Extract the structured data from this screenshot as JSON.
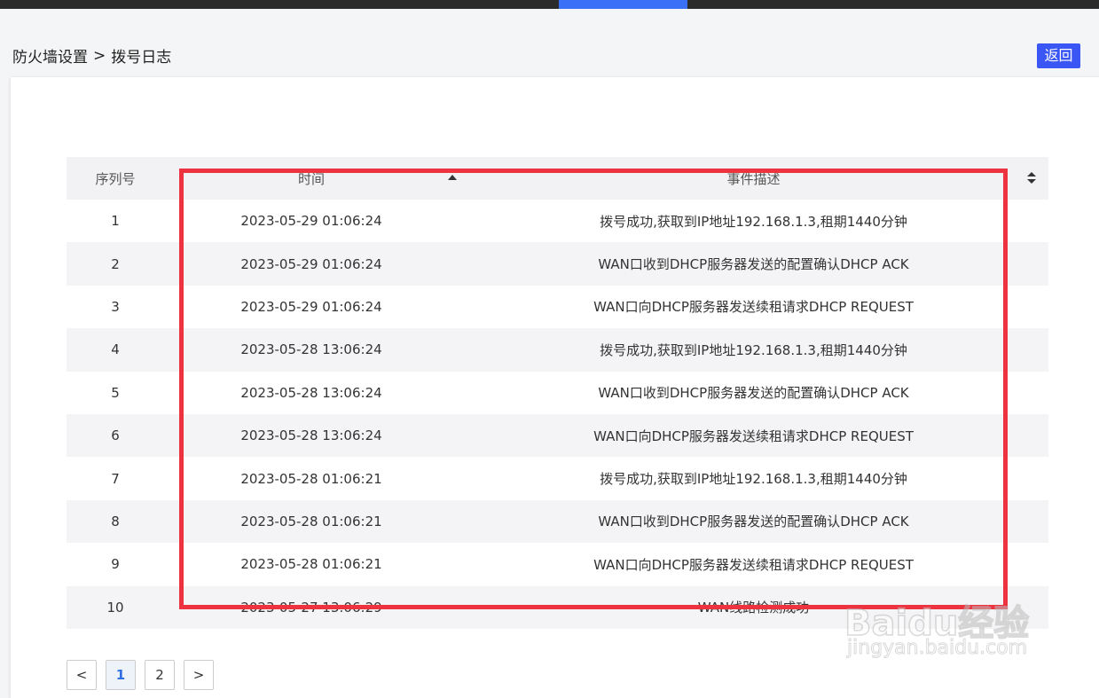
{
  "breadcrumb": {
    "parent": "防火墙设置",
    "separator": ">",
    "current": "拨号日志"
  },
  "back_button": "返回",
  "table": {
    "headers": [
      "序列号",
      "时间",
      "事件描述"
    ],
    "rows": [
      {
        "seq": "1",
        "time": "2023-05-29 01:06:24",
        "desc": "拨号成功,获取到IP地址192.168.1.3,租期1440分钟"
      },
      {
        "seq": "2",
        "time": "2023-05-29 01:06:24",
        "desc": "WAN口收到DHCP服务器发送的配置确认DHCP ACK"
      },
      {
        "seq": "3",
        "time": "2023-05-29 01:06:24",
        "desc": "WAN口向DHCP服务器发送续租请求DHCP REQUEST"
      },
      {
        "seq": "4",
        "time": "2023-05-28 13:06:24",
        "desc": "拨号成功,获取到IP地址192.168.1.3,租期1440分钟"
      },
      {
        "seq": "5",
        "time": "2023-05-28 13:06:24",
        "desc": "WAN口收到DHCP服务器发送的配置确认DHCP ACK"
      },
      {
        "seq": "6",
        "time": "2023-05-28 13:06:24",
        "desc": "WAN口向DHCP服务器发送续租请求DHCP REQUEST"
      },
      {
        "seq": "7",
        "time": "2023-05-28 01:06:21",
        "desc": "拨号成功,获取到IP地址192.168.1.3,租期1440分钟"
      },
      {
        "seq": "8",
        "time": "2023-05-28 01:06:21",
        "desc": "WAN口收到DHCP服务器发送的配置确认DHCP ACK"
      },
      {
        "seq": "9",
        "time": "2023-05-28 01:06:21",
        "desc": "WAN口向DHCP服务器发送续租请求DHCP REQUEST"
      },
      {
        "seq": "10",
        "time": "2023-05-27 13:06:29",
        "desc": "WAN线路检测成功"
      }
    ]
  },
  "pagination": {
    "prev": "<",
    "pages": [
      "1",
      "2"
    ],
    "current": "1",
    "next": ">"
  },
  "watermark": {
    "text": "Baidu经验",
    "sub": "jingyan.baidu.com"
  },
  "colors": {
    "accent": "#3a56f5",
    "highlight": "#ee3340"
  }
}
